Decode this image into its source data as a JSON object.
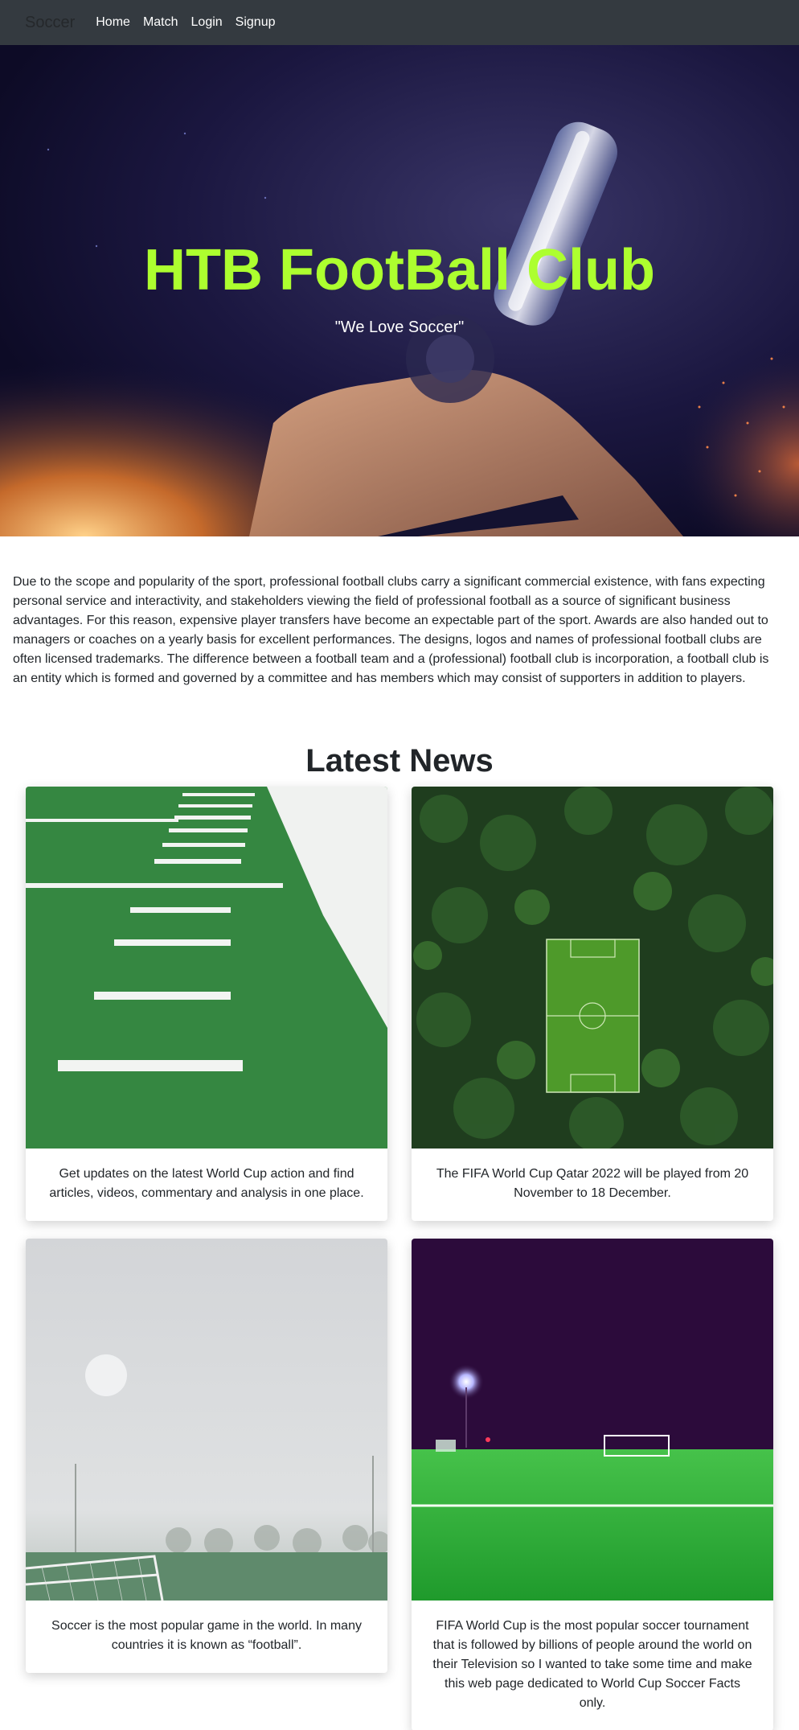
{
  "navbar": {
    "brand": "Soccer",
    "links": [
      "Home",
      "Match",
      "Login",
      "Signup"
    ]
  },
  "hero": {
    "title": "HTB FootBall Club",
    "subtitle": "\"We Love Soccer\""
  },
  "about": {
    "text": "Due to the scope and popularity of the sport, professional football clubs carry a significant commercial existence, with fans expecting personal service and interactivity, and stakeholders viewing the field of professional football as a source of significant business advantages. For this reason, expensive player transfers have become an expectable part of the sport. Awards are also handed out to managers or coaches on a yearly basis for excellent performances. The designs, logos and names of professional football clubs are often licensed trademarks. The difference between a football team and a (professional) football club is incorporation, a football club is an entity which is formed and governed by a committee and has members which may consist of supporters in addition to players."
  },
  "news": {
    "title": "Latest News",
    "cards": [
      {
        "text": "Get updates on the latest World Cup action and find articles, videos, commentary and analysis in one place."
      },
      {
        "text": "The FIFA World Cup Qatar 2022 will be played from 20 November to 18 December."
      },
      {
        "text": "Soccer is the most popular game in the world. In many countries it is known as “football”."
      },
      {
        "text": "FIFA World Cup is the most popular soccer tournament that is followed by billions of people around the world on their Television so I wanted to take some time and make this web page dedicated to World Cup Soccer Facts only."
      }
    ]
  },
  "colors": {
    "navbar_bg": "#343a40",
    "hero_title": "#adff2f",
    "hero_bg": "#17143a"
  }
}
